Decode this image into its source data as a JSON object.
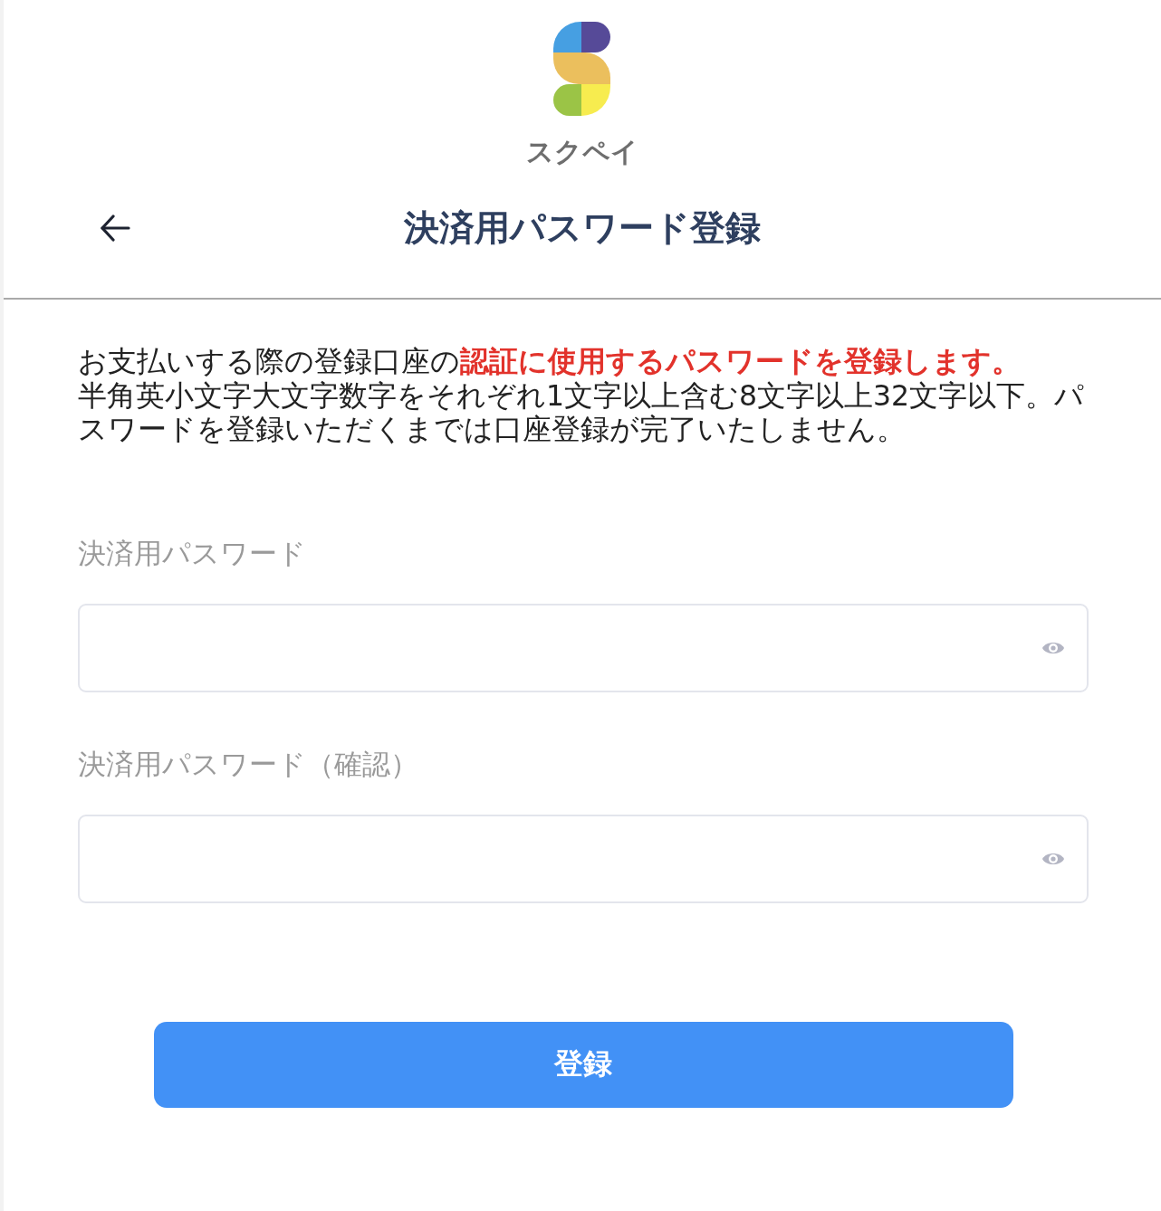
{
  "logo": {
    "wordmark": "スクペイ"
  },
  "header": {
    "title": "決済用パスワード登録"
  },
  "description": {
    "intro": "お支払いする際の登録口座の**認証に使用するパスワードを登録します。**",
    "requirements": "半角英小文字大文字数字をそれぞれ1文字以上含む8文字以上32文字以下。パスワードを登録いただくまでは口座登録が完了いたしません。"
  },
  "fields": [
    {
      "label": "決済用パスワード"
    },
    {
      "label": "決済用パスワード（確認）"
    }
  ],
  "submit": {
    "label": "登録"
  }
}
